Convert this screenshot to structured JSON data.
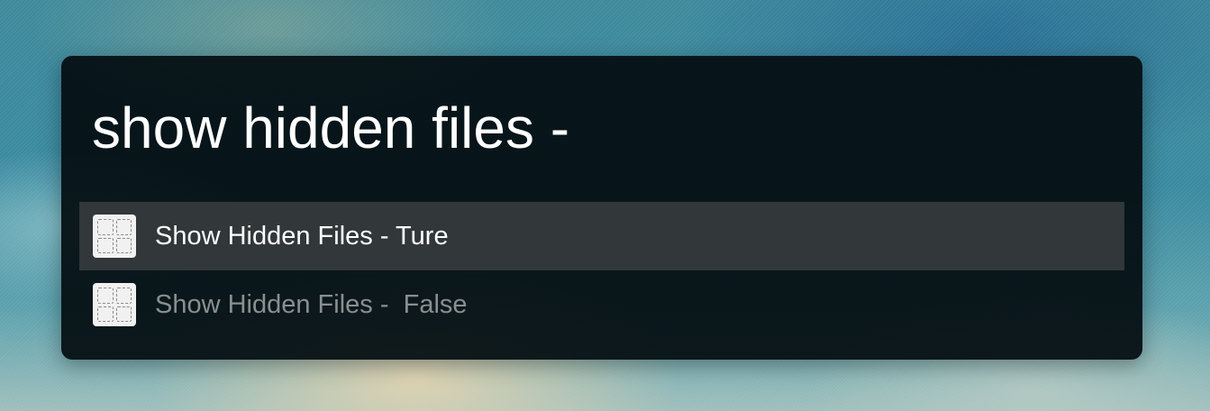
{
  "launcher": {
    "query": "show hidden files -",
    "results": [
      {
        "title": "Show Hidden Files - Ture",
        "icon": "grid-tile-icon",
        "selected": true
      },
      {
        "title": "Show Hidden Files -  False",
        "icon": "grid-tile-icon",
        "selected": false
      }
    ]
  },
  "colors": {
    "panel_background": "#040e12",
    "selected_row": "#323739",
    "primary_text": "#ffffff",
    "secondary_text": "#8a8f90"
  }
}
